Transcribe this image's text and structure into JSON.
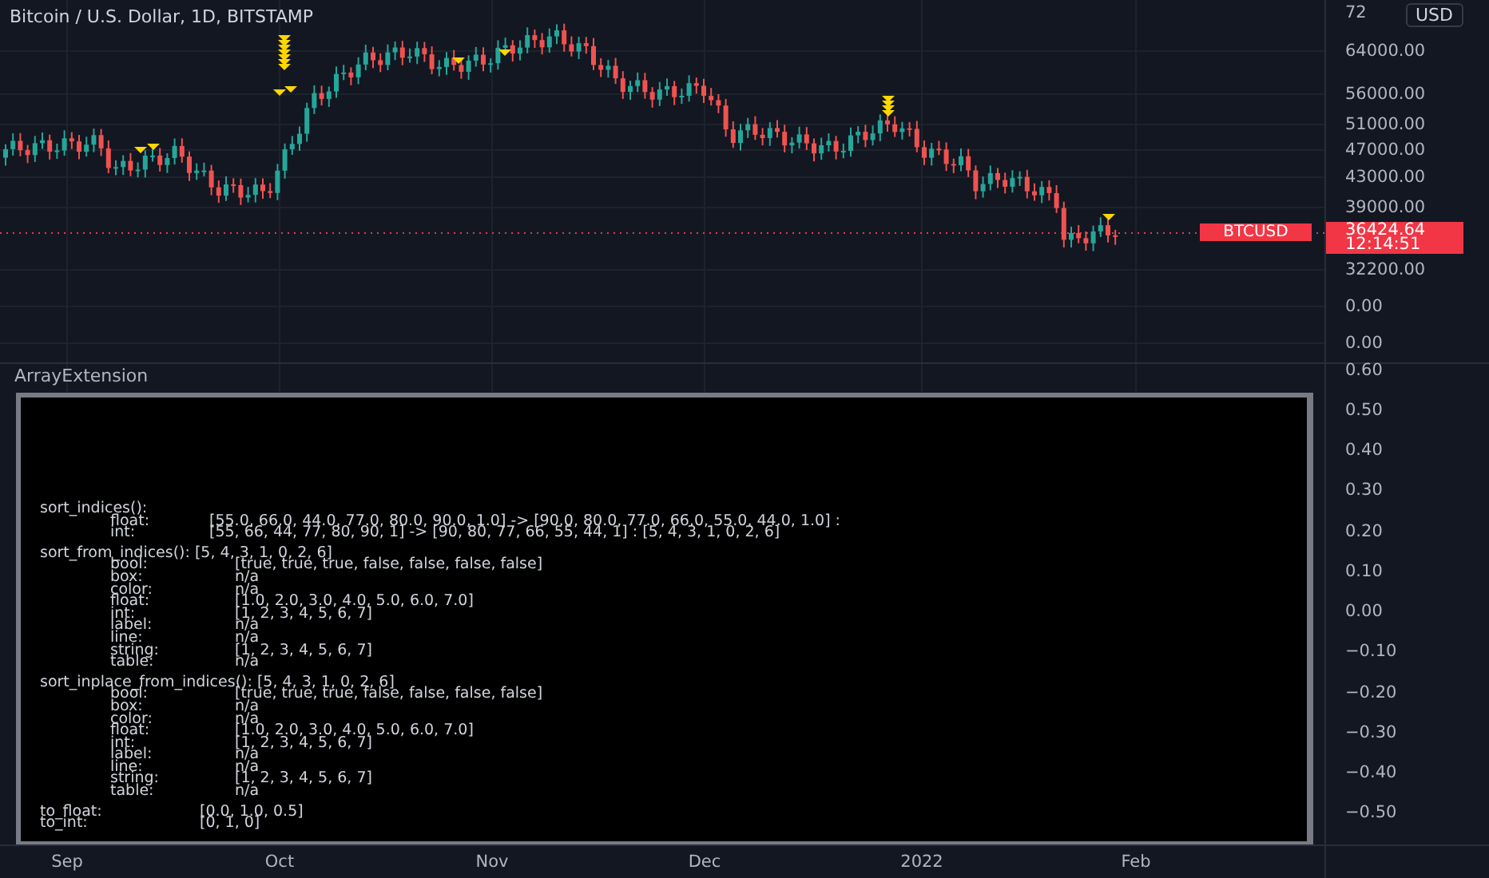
{
  "chart": {
    "title": "Bitcoin / U.S. Dollar, 1D, BITSTAMP",
    "currency": "USD",
    "price_axis": [
      "72",
      "64000.00",
      "56000.00",
      "51000.00",
      "47000.00",
      "43000.00",
      "39000.00",
      "32200.00",
      "0.00",
      "0.00"
    ],
    "symbol_label": "BTCUSD",
    "last_price": "36424.64",
    "countdown": "12:14:51"
  },
  "indicator": {
    "name": "ArrayExtension",
    "axis": [
      "0.60",
      "0.50",
      "0.40",
      "0.30",
      "0.20",
      "0.10",
      "0.00",
      "−0.10",
      "−0.20",
      "−0.30",
      "−0.40",
      "−0.50"
    ],
    "sections": [
      {
        "heading": "sort_indices():",
        "rows": [
          {
            "key": "float:",
            "value": "[55.0, 66.0, 44.0, 77.0, 80.0, 90.0, 1.0] -> [90.0, 80.0, 77.0, 66.0, 55.0, 44.0, 1.0] :"
          },
          {
            "key": "int:",
            "value": "[55, 66, 44, 77, 80, 90, 1] -> [90, 80, 77, 66, 55, 44, 1] : [5, 4, 3, 1, 0, 2, 6]"
          }
        ]
      },
      {
        "heading": "sort_from_indices(): [5, 4, 3, 1, 0, 2, 6]",
        "rows": [
          {
            "key": "bool:",
            "value": "[true, true, true, false, false, false, false]"
          },
          {
            "key": "box:",
            "value": "n/a"
          },
          {
            "key": "color:",
            "value": "n/a"
          },
          {
            "key": "float:",
            "value": "[1.0, 2.0, 3.0, 4.0, 5.0, 6.0, 7.0]"
          },
          {
            "key": "int:",
            "value": "[1, 2, 3, 4, 5, 6, 7]"
          },
          {
            "key": "label:",
            "value": "n/a"
          },
          {
            "key": "line:",
            "value": "n/a"
          },
          {
            "key": "string:",
            "value": "[1, 2, 3, 4, 5, 6, 7]"
          },
          {
            "key": "table:",
            "value": "n/a"
          }
        ]
      },
      {
        "heading": "sort_inplace_from_indices(): [5, 4, 3, 1, 0, 2, 6]",
        "rows": [
          {
            "key": "bool:",
            "value": "[true, true, true, false, false, false, false]"
          },
          {
            "key": "box:",
            "value": "n/a"
          },
          {
            "key": "color:",
            "value": "n/a"
          },
          {
            "key": "float:",
            "value": "[1.0, 2.0, 3.0, 4.0, 5.0, 6.0, 7.0]"
          },
          {
            "key": "int:",
            "value": "[1, 2, 3, 4, 5, 6, 7]"
          },
          {
            "key": "label:",
            "value": "n/a"
          },
          {
            "key": "line:",
            "value": "n/a"
          },
          {
            "key": "string:",
            "value": "[1, 2, 3, 4, 5, 6, 7]"
          },
          {
            "key": "table:",
            "value": "n/a"
          }
        ]
      },
      {
        "rows": [
          {
            "key": "to_float:",
            "value": "[0.0, 1.0, 0.5]"
          },
          {
            "key": "to_int:",
            "value": "[0, 1, 0]"
          }
        ]
      }
    ]
  },
  "time_axis": [
    "Sep",
    "Oct",
    "Nov",
    "Dec",
    "2022",
    "Feb"
  ]
}
